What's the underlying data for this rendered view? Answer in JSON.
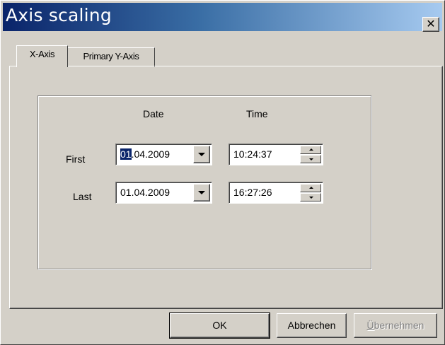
{
  "window": {
    "title": "Axis scaling",
    "close_glyph": "✕"
  },
  "tabs": [
    {
      "label": "X-Axis",
      "active": true
    },
    {
      "label": "Primary Y-Axis",
      "active": false
    }
  ],
  "columns": {
    "date_header": "Date",
    "time_header": "Time"
  },
  "rows": [
    {
      "label": "First",
      "date_selected": "01",
      "date_rest": ".04.2009",
      "time": "10:24:37"
    },
    {
      "label": "Last",
      "date": "01.04.2009",
      "time": "16:27:26"
    }
  ],
  "buttons": {
    "ok": "OK",
    "cancel": "Abbrechen",
    "apply_underlined": "Ü",
    "apply_rest": "bernehmen"
  },
  "icons": {
    "close": "close-icon",
    "dropdown": "chevron-down-icon",
    "spin_up": "spin-up-icon",
    "spin_down": "spin-down-icon"
  }
}
